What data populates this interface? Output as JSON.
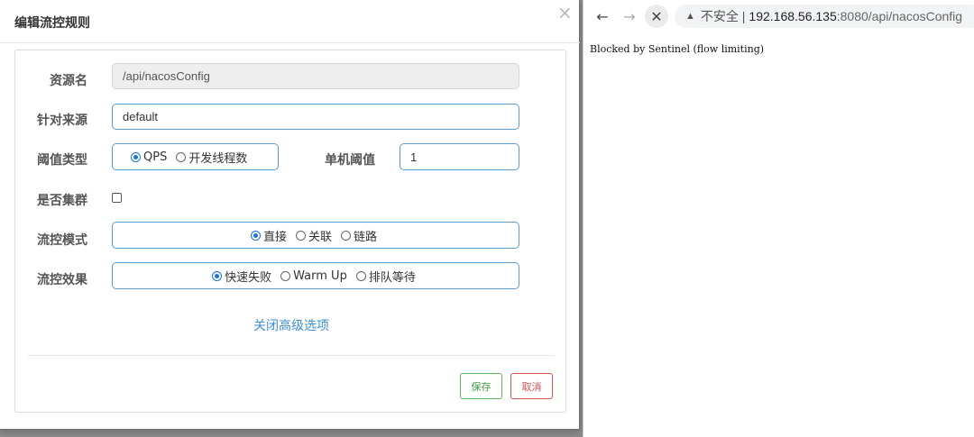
{
  "dialog": {
    "title": "编辑流控规则",
    "close_icon": "×",
    "resource_label": "资源名",
    "resource_value": "/api/nacosConfig",
    "source_label": "针对来源",
    "source_value": "default",
    "threshold_type_label": "阈值类型",
    "threshold_type_options": [
      {
        "label": "QPS",
        "checked": true
      },
      {
        "label": "开发线程数",
        "checked": false
      }
    ],
    "single_threshold_label": "单机阈值",
    "single_threshold_value": "1",
    "cluster_label": "是否集群",
    "cluster_checked": false,
    "mode_label": "流控模式",
    "mode_options": [
      {
        "label": "直接",
        "checked": true
      },
      {
        "label": "关联",
        "checked": false
      },
      {
        "label": "链路",
        "checked": false
      }
    ],
    "effect_label": "流控效果",
    "effect_options": [
      {
        "label": "快速失败",
        "checked": true
      },
      {
        "label": "Warm Up",
        "checked": false
      },
      {
        "label": "排队等待",
        "checked": false
      }
    ],
    "advanced_link": "关闭高级选项",
    "save_label": "保存",
    "cancel_label": "取消"
  },
  "browser": {
    "back_icon": "←",
    "forward_icon": "→",
    "stop_icon": "✕",
    "warning_icon": "▲",
    "insecure_label": "不安全 |",
    "url_host": "192.168.56.135",
    "url_path": ":8080/api/nacosConfig",
    "body_text": "Blocked by Sentinel (flow limiting)"
  },
  "colors": {
    "accent_blue": "#5b9bd5",
    "link_blue": "#3a8fd6",
    "save_green": "#5cb85c",
    "cancel_red": "#d9534f"
  }
}
